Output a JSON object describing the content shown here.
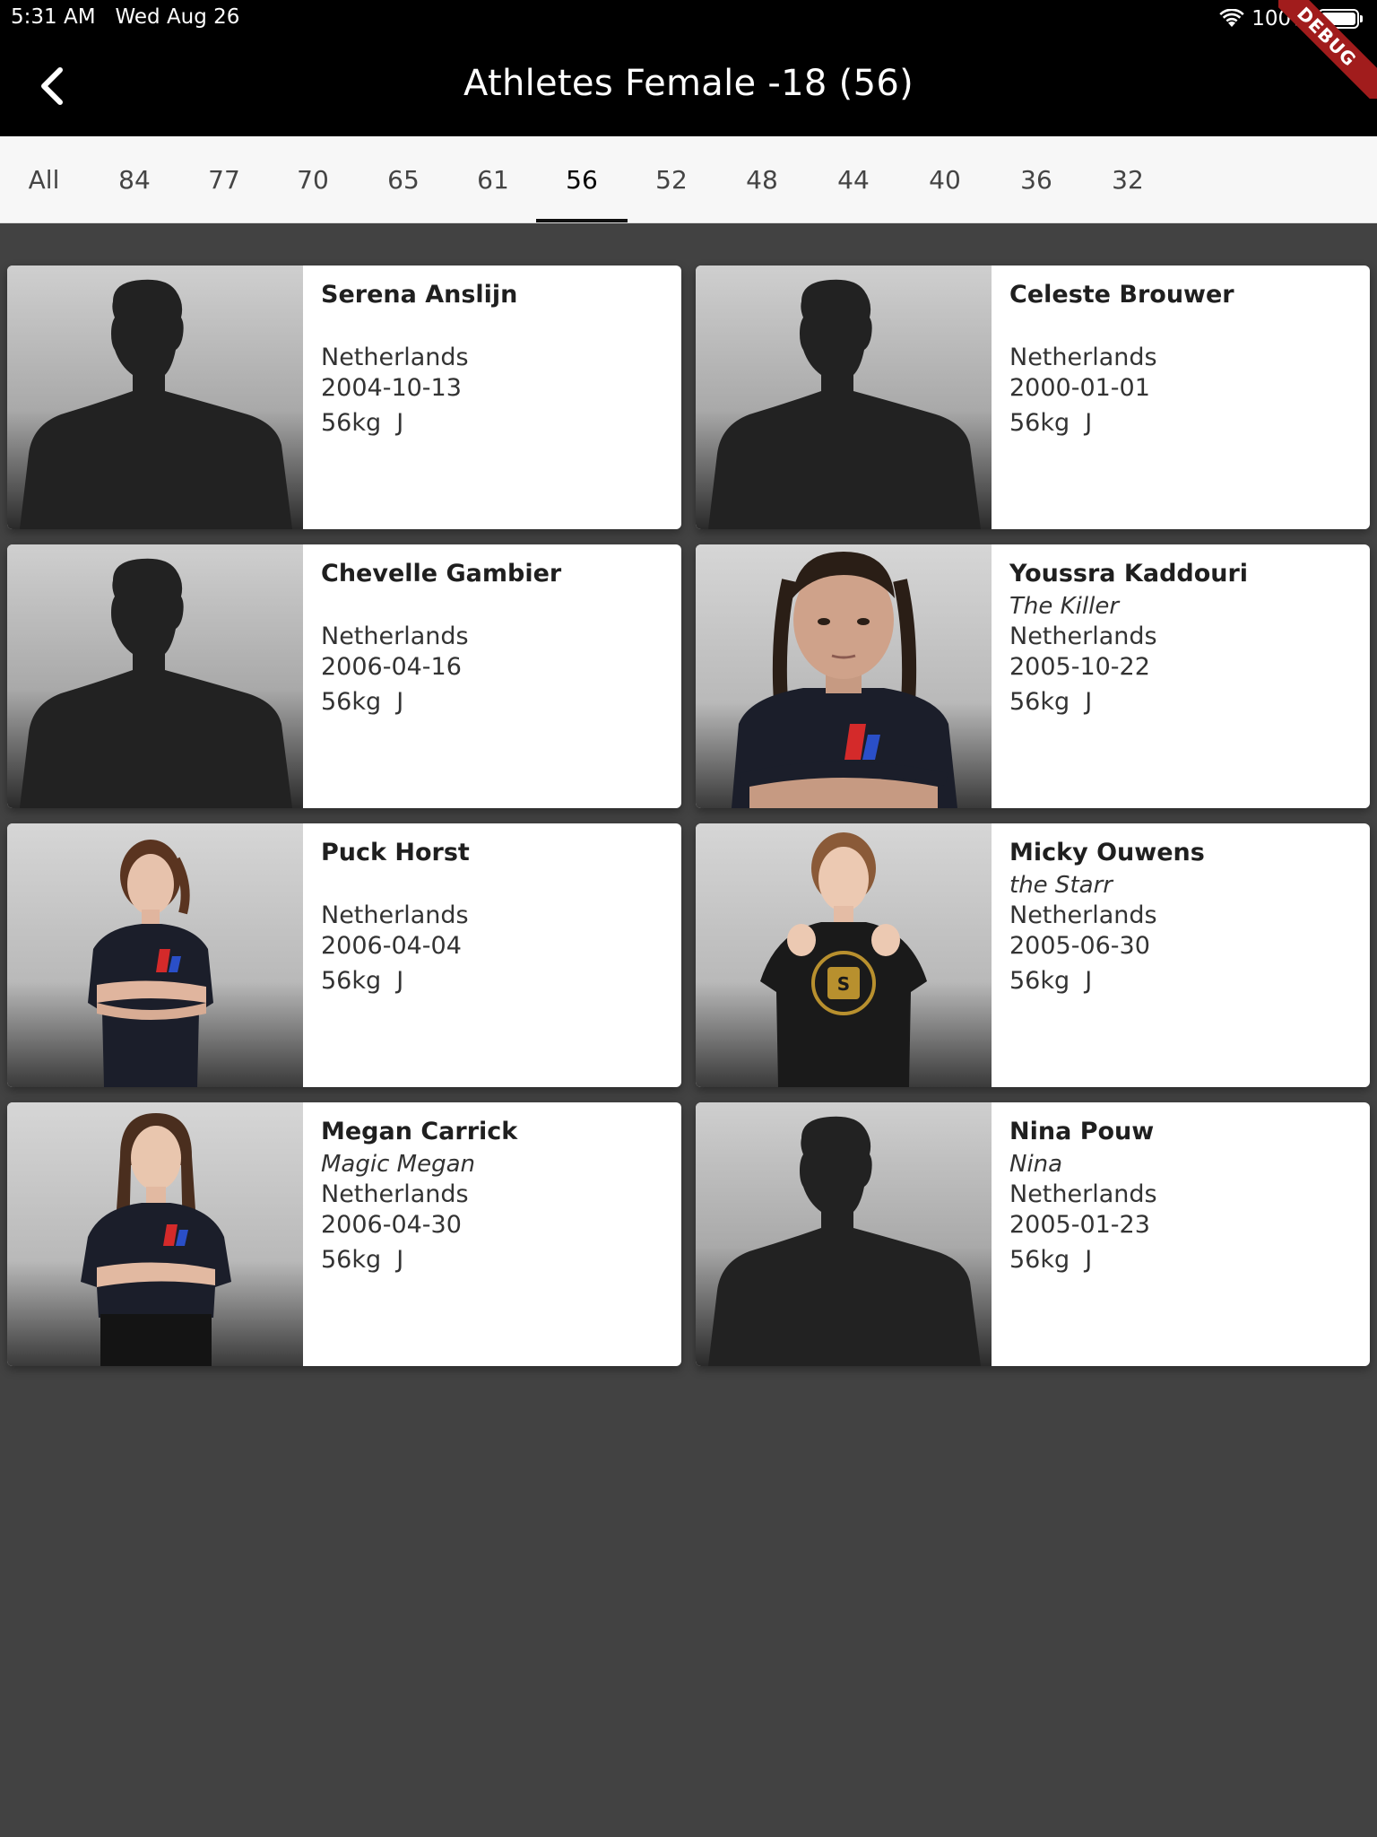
{
  "status_bar": {
    "time": "5:31 AM",
    "date": "Wed Aug 26",
    "battery": "100%"
  },
  "app_bar": {
    "title": "Athletes Female -18 (56)",
    "debug_label": "DEBUG"
  },
  "tabs": [
    {
      "label": "All"
    },
    {
      "label": "84"
    },
    {
      "label": "77"
    },
    {
      "label": "70"
    },
    {
      "label": "65"
    },
    {
      "label": "61"
    },
    {
      "label": "56",
      "active": true
    },
    {
      "label": "52"
    },
    {
      "label": "48"
    },
    {
      "label": "44"
    },
    {
      "label": "40"
    },
    {
      "label": "36"
    },
    {
      "label": "32"
    }
  ],
  "athletes": [
    {
      "name": "Serena Anslijn",
      "nickname": "",
      "country": "Netherlands",
      "dob": "2004-10-13",
      "weight": "56kg  J",
      "photo": "silhouette"
    },
    {
      "name": "Celeste Brouwer",
      "nickname": "",
      "country": "Netherlands",
      "dob": "2000-01-01",
      "weight": "56kg  J",
      "photo": "silhouette"
    },
    {
      "name": "Chevelle Gambier",
      "nickname": "",
      "country": "Netherlands",
      "dob": "2006-04-16",
      "weight": "56kg  J",
      "photo": "silhouette"
    },
    {
      "name": "Youssra Kaddouri",
      "nickname": "The Killer",
      "country": "Netherlands",
      "dob": "2005-10-22",
      "weight": "56kg  J",
      "photo": "portrait-closeup"
    },
    {
      "name": "Puck Horst",
      "nickname": "",
      "country": "Netherlands",
      "dob": "2006-04-04",
      "weight": "56kg  J",
      "photo": "portrait-full"
    },
    {
      "name": "Micky Ouwens",
      "nickname": "the Starr",
      "country": "Netherlands",
      "dob": "2005-06-30",
      "weight": "56kg  J",
      "photo": "portrait-fists"
    },
    {
      "name": "Megan Carrick",
      "nickname": "Magic Megan",
      "country": "Netherlands",
      "dob": "2006-04-30",
      "weight": "56kg  J",
      "photo": "portrait-full"
    },
    {
      "name": "Nina Pouw",
      "nickname": "Nina",
      "country": "Netherlands",
      "dob": "2005-01-23",
      "weight": "56kg  J",
      "photo": "silhouette"
    }
  ]
}
